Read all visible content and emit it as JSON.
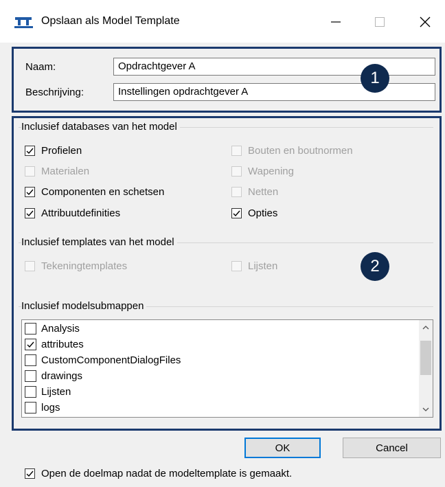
{
  "window": {
    "title": "Opslaan als Model Template"
  },
  "form": {
    "name_label": "Naam:",
    "name_value": "Opdrachtgever A",
    "description_label": "Beschrijving:",
    "description_value": "Instellingen opdrachtgever A"
  },
  "badges": {
    "one": "1",
    "two": "2"
  },
  "databases": {
    "title": "Inclusief databases van het model",
    "items": [
      {
        "label": "Profielen",
        "checked": true,
        "enabled": true
      },
      {
        "label": "Materialen",
        "checked": false,
        "enabled": false
      },
      {
        "label": "Componenten en schetsen",
        "checked": true,
        "enabled": true
      },
      {
        "label": "Attribuutdefinities",
        "checked": true,
        "enabled": true
      },
      {
        "label": "Bouten en boutnormen",
        "checked": false,
        "enabled": false
      },
      {
        "label": "Wapening",
        "checked": false,
        "enabled": false
      },
      {
        "label": "Netten",
        "checked": false,
        "enabled": false
      },
      {
        "label": "Opties",
        "checked": true,
        "enabled": true
      }
    ]
  },
  "templates": {
    "title": "Inclusief templates van het model",
    "items": [
      {
        "label": "Tekeningtemplates",
        "checked": false,
        "enabled": false
      },
      {
        "label": "Lijsten",
        "checked": false,
        "enabled": false
      }
    ]
  },
  "subfolders": {
    "title": "Inclusief modelsubmappen",
    "items": [
      {
        "label": "Analysis",
        "checked": false
      },
      {
        "label": "attributes",
        "checked": true
      },
      {
        "label": "CustomComponentDialogFiles",
        "checked": false
      },
      {
        "label": "drawings",
        "checked": false
      },
      {
        "label": "Lijsten",
        "checked": false
      },
      {
        "label": "logs",
        "checked": false
      }
    ]
  },
  "buttons": {
    "ok": "OK",
    "cancel": "Cancel"
  },
  "footer": {
    "open_folder_label": "Open de doelmap nadat de modeltemplate is gemaakt.",
    "open_folder_checked": true
  },
  "colors": {
    "accent": "#0078d7",
    "highlight_border": "#1b3a6e",
    "badge": "#0f2a4f"
  }
}
